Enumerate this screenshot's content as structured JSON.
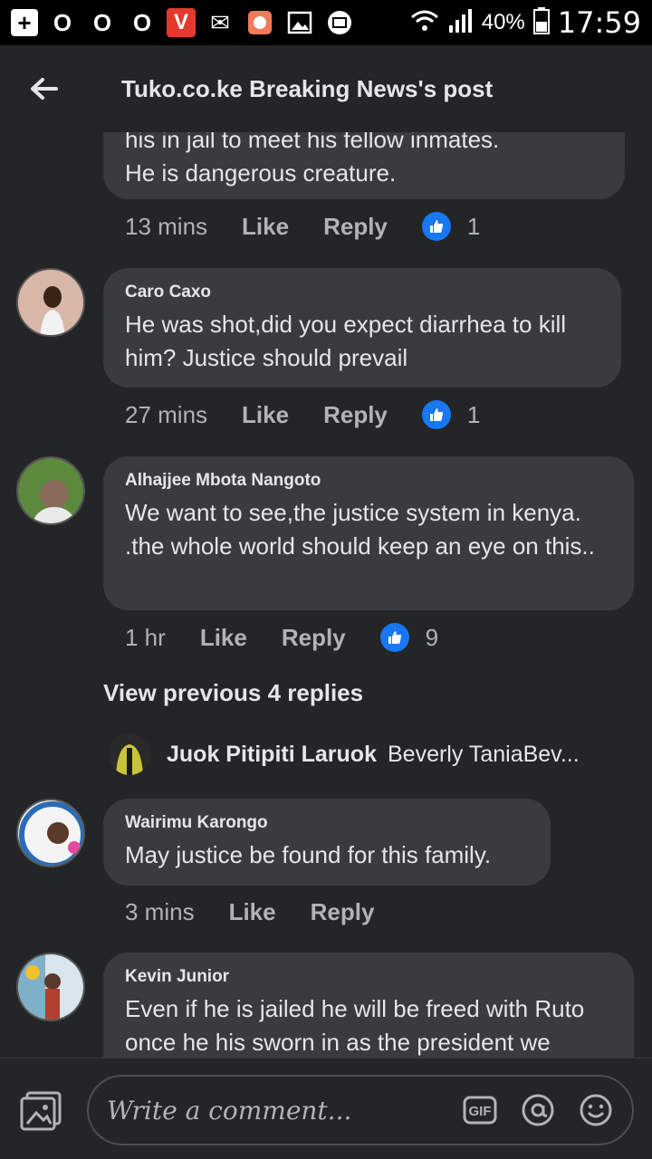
{
  "status_bar": {
    "battery": "40%",
    "time": "17:59"
  },
  "header": {
    "title": "Tuko.co.ke Breaking News's post"
  },
  "comments": [
    {
      "text": "his in jail to meet his fellow inmates.\nHe is dangerous creature.",
      "time": "13 mins",
      "like": "Like",
      "reply": "Reply",
      "reactions": "1"
    },
    {
      "name": "Caro Caxo",
      "text": "He was shot,did you expect diarrhea to kill him? Justice should prevail",
      "time": "27 mins",
      "like": "Like",
      "reply": "Reply",
      "reactions": "1"
    },
    {
      "name": "Alhajjee Mbota Nangoto",
      "text": "We want to see,the justice system in kenya. .the whole world should keep an eye on this..",
      "time": "1 hr",
      "like": "Like",
      "reply": "Reply",
      "reactions": "9",
      "view_previous": "View previous 4 replies",
      "latest_reply": {
        "name": "Juok Pitipiti Laruok",
        "preview": "Beverly TaniaBev..."
      }
    },
    {
      "name": "Wairimu Karongo",
      "text": "May justice be found for this family.",
      "time": "3 mins",
      "like": "Like",
      "reply": "Reply"
    },
    {
      "name": "Kevin Junior",
      "text": "Even if he is jailed he will be freed with Ruto once he his sworn in as the president we"
    }
  ],
  "composer": {
    "placeholder": "Write a comment...",
    "gif_label": "GIF"
  },
  "colors": {
    "background": "#242526",
    "bubble": "#3a3b3c",
    "accent": "#1877f2"
  },
  "icons": [
    "back-arrow-icon",
    "thumbs-up-icon",
    "photo-icon",
    "gif-icon",
    "at-mention-icon",
    "emoji-icon"
  ]
}
